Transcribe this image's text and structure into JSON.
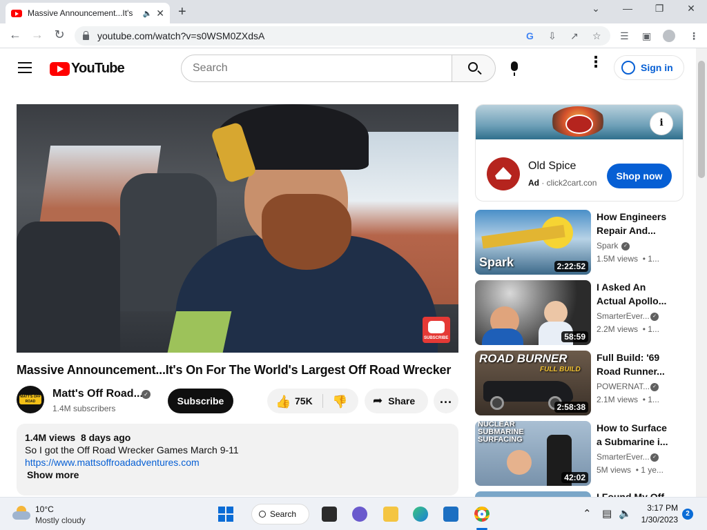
{
  "browser": {
    "tab_title": "Massive Announcement...It's",
    "url": "youtube.com/watch?v=s0WSM0ZXdsA"
  },
  "header": {
    "logo_text": "YouTube",
    "search_placeholder": "Search",
    "sign_in_label": "Sign in"
  },
  "video": {
    "title": "Massive Announcement...It's On For The World's Largest Off Road Wrecker",
    "watermark_text": "SUBSCRIBE",
    "channel_name": "Matt's Off Road...",
    "channel_logo_text": "MATT'S OFF ROAD",
    "subscribers": "1.4M subscribers",
    "subscribe_label": "Subscribe",
    "like_count": "75K",
    "share_label": "Share",
    "more_label": "...",
    "views": "1.4M views",
    "age": "8 days ago",
    "description": "So I got the Off Road Wrecker Games March 9-11",
    "link": "https://www.mattsoffroadadventures.com",
    "show_more_label": "Show more"
  },
  "ad": {
    "info_label": "i",
    "advertiser": "Old Spice",
    "ad_badge": "Ad",
    "domain": "click2cart.con",
    "cta": "Shop now"
  },
  "recommendations": [
    {
      "title": "How Engineers Repair And...",
      "channel": "Spark",
      "views": "1.5M views",
      "age": "• 1...",
      "duration": "2:22:52",
      "thumb_text": "Spark"
    },
    {
      "title": "I Asked An Actual Apollo...",
      "channel": "SmarterEver...",
      "views": "2.2M views",
      "age": "• 1...",
      "duration": "58:59",
      "thumb_text": ""
    },
    {
      "title": "Full Build: '69 Road Runner...",
      "channel": "POWERNAT...",
      "views": "2.1M views",
      "age": "• 1...",
      "duration": "2:58:38",
      "thumb_text": "ROAD BURNER",
      "thumb_text2": "FULL BUILD"
    },
    {
      "title": "How to Surface a Submarine i...",
      "channel": "SmarterEver...",
      "views": "5M views",
      "age": "• 1 ye...",
      "duration": "42:02",
      "thumb_text": "NUCLEAR SUBMARINE SURFACING"
    },
    {
      "title": "I Found My Off",
      "channel": "",
      "views": "",
      "age": "",
      "duration": ""
    }
  ],
  "taskbar": {
    "temperature": "10°C",
    "condition": "Mostly cloudy",
    "search_label": "Search",
    "time": "3:17 PM",
    "date": "1/30/2023",
    "notifications": "2"
  }
}
